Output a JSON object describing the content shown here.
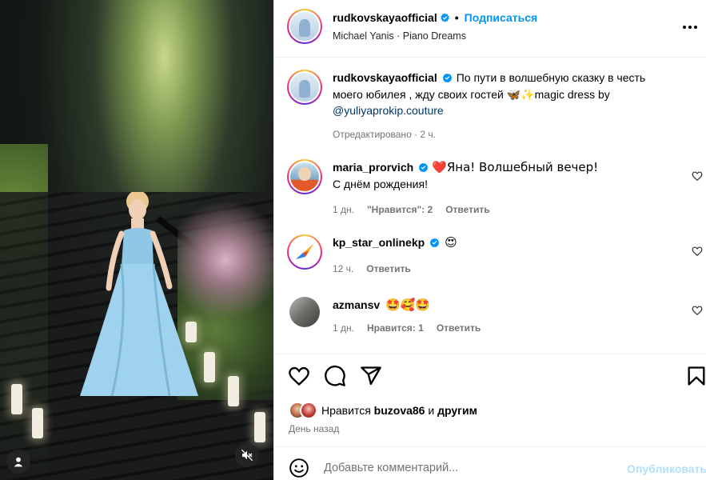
{
  "media": {
    "user_icon": "user-tag-icon",
    "mute_icon": "speaker-muted-icon"
  },
  "header": {
    "username": "rudkovskaya​official",
    "separator": "•",
    "follow_label": "Подписаться",
    "audio": "Michael Yanis · Piano Dreams",
    "more_icon": "more-horizontal-icon"
  },
  "caption": {
    "username": "rudkovskayaofficial",
    "text": "По пути в волшебную сказку в честь моего юбилея , жду своих гостей 🦋✨magic dress by",
    "link": "@yuliyaprokip.couture",
    "meta": "Отредактировано · 2 ч."
  },
  "comments": [
    {
      "username": "maria_prorvich",
      "text_line1": "❤️Яна! Волшебный вечер!",
      "text_line2": "С днём рождения!",
      "time": "1 дн.",
      "likes": "\"Нравится\": 2",
      "reply": "Ответить"
    },
    {
      "username": "kp_star_onlinekp",
      "text": "😍",
      "time": "12 ч.",
      "reply": "Ответить"
    },
    {
      "username": "azmansv",
      "text": "🤩🥰🤩",
      "time": "1 дн.",
      "likes": "Нравится: 1",
      "reply": "Ответить"
    }
  ],
  "actions": {
    "like_icon": "heart-icon",
    "comment_icon": "comment-icon",
    "share_icon": "send-icon",
    "save_icon": "bookmark-icon"
  },
  "likes": {
    "prefix": "Нравится",
    "user": "buzova86",
    "conj": "и",
    "others": "другим"
  },
  "date": "День назад",
  "add_comment": {
    "placeholder": "Добавьте комментарий...",
    "publish_label": "Опубликовать",
    "emoji_icon": "emoji-icon"
  },
  "colors": {
    "accent": "#0095f6",
    "link": "#00376b",
    "muted": "#737373",
    "publish_disabled": "#b2dffc",
    "heart_red": "#ed4956"
  }
}
